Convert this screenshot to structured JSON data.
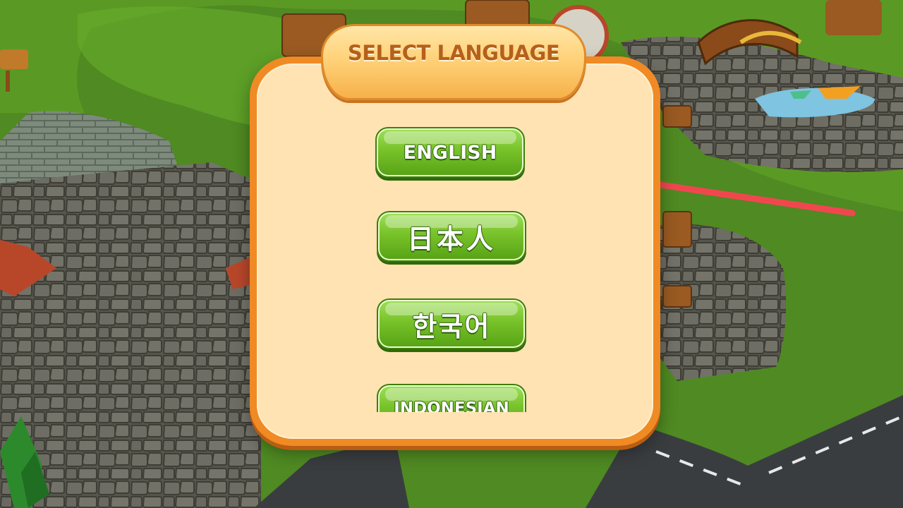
{
  "dialog": {
    "title": "SELECT LANGUAGE",
    "languages": [
      {
        "label": "ENGLISH"
      },
      {
        "label": "日本人"
      },
      {
        "label": "한국어"
      },
      {
        "label": "INDONESIAN"
      }
    ]
  },
  "colors": {
    "panel_border": "#f08a24",
    "panel_fill": "#ffe3b3",
    "title": "#b5601c",
    "button_green": "#78c22a",
    "arrow": "#f0474f",
    "grass": "#4f8a22",
    "stone": "#6b6a60",
    "road": "#3a3d40"
  },
  "icons": [
    "arrow-pointer-icon",
    "tree-icon",
    "fence-icon",
    "bridge-icon",
    "boat-icon",
    "sign-icon"
  ]
}
